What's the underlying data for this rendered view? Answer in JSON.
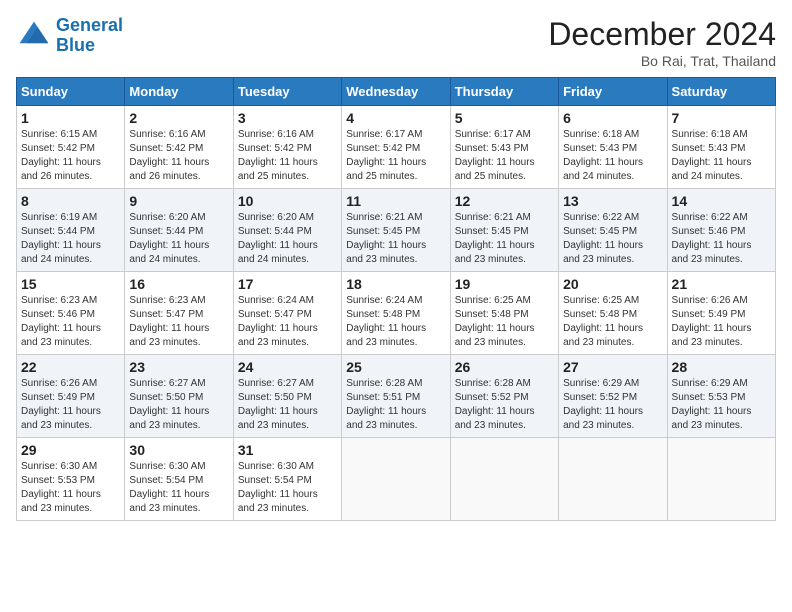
{
  "header": {
    "logo_line1": "General",
    "logo_line2": "Blue",
    "month_title": "December 2024",
    "location": "Bo Rai, Trat, Thailand"
  },
  "days_of_week": [
    "Sunday",
    "Monday",
    "Tuesday",
    "Wednesday",
    "Thursday",
    "Friday",
    "Saturday"
  ],
  "weeks": [
    [
      {
        "day": "1",
        "sunrise": "6:15 AM",
        "sunset": "5:42 PM",
        "daylight": "11 hours and 26 minutes."
      },
      {
        "day": "2",
        "sunrise": "6:16 AM",
        "sunset": "5:42 PM",
        "daylight": "11 hours and 26 minutes."
      },
      {
        "day": "3",
        "sunrise": "6:16 AM",
        "sunset": "5:42 PM",
        "daylight": "11 hours and 25 minutes."
      },
      {
        "day": "4",
        "sunrise": "6:17 AM",
        "sunset": "5:42 PM",
        "daylight": "11 hours and 25 minutes."
      },
      {
        "day": "5",
        "sunrise": "6:17 AM",
        "sunset": "5:43 PM",
        "daylight": "11 hours and 25 minutes."
      },
      {
        "day": "6",
        "sunrise": "6:18 AM",
        "sunset": "5:43 PM",
        "daylight": "11 hours and 24 minutes."
      },
      {
        "day": "7",
        "sunrise": "6:18 AM",
        "sunset": "5:43 PM",
        "daylight": "11 hours and 24 minutes."
      }
    ],
    [
      {
        "day": "8",
        "sunrise": "6:19 AM",
        "sunset": "5:44 PM",
        "daylight": "11 hours and 24 minutes."
      },
      {
        "day": "9",
        "sunrise": "6:20 AM",
        "sunset": "5:44 PM",
        "daylight": "11 hours and 24 minutes."
      },
      {
        "day": "10",
        "sunrise": "6:20 AM",
        "sunset": "5:44 PM",
        "daylight": "11 hours and 24 minutes."
      },
      {
        "day": "11",
        "sunrise": "6:21 AM",
        "sunset": "5:45 PM",
        "daylight": "11 hours and 23 minutes."
      },
      {
        "day": "12",
        "sunrise": "6:21 AM",
        "sunset": "5:45 PM",
        "daylight": "11 hours and 23 minutes."
      },
      {
        "day": "13",
        "sunrise": "6:22 AM",
        "sunset": "5:45 PM",
        "daylight": "11 hours and 23 minutes."
      },
      {
        "day": "14",
        "sunrise": "6:22 AM",
        "sunset": "5:46 PM",
        "daylight": "11 hours and 23 minutes."
      }
    ],
    [
      {
        "day": "15",
        "sunrise": "6:23 AM",
        "sunset": "5:46 PM",
        "daylight": "11 hours and 23 minutes."
      },
      {
        "day": "16",
        "sunrise": "6:23 AM",
        "sunset": "5:47 PM",
        "daylight": "11 hours and 23 minutes."
      },
      {
        "day": "17",
        "sunrise": "6:24 AM",
        "sunset": "5:47 PM",
        "daylight": "11 hours and 23 minutes."
      },
      {
        "day": "18",
        "sunrise": "6:24 AM",
        "sunset": "5:48 PM",
        "daylight": "11 hours and 23 minutes."
      },
      {
        "day": "19",
        "sunrise": "6:25 AM",
        "sunset": "5:48 PM",
        "daylight": "11 hours and 23 minutes."
      },
      {
        "day": "20",
        "sunrise": "6:25 AM",
        "sunset": "5:48 PM",
        "daylight": "11 hours and 23 minutes."
      },
      {
        "day": "21",
        "sunrise": "6:26 AM",
        "sunset": "5:49 PM",
        "daylight": "11 hours and 23 minutes."
      }
    ],
    [
      {
        "day": "22",
        "sunrise": "6:26 AM",
        "sunset": "5:49 PM",
        "daylight": "11 hours and 23 minutes."
      },
      {
        "day": "23",
        "sunrise": "6:27 AM",
        "sunset": "5:50 PM",
        "daylight": "11 hours and 23 minutes."
      },
      {
        "day": "24",
        "sunrise": "6:27 AM",
        "sunset": "5:50 PM",
        "daylight": "11 hours and 23 minutes."
      },
      {
        "day": "25",
        "sunrise": "6:28 AM",
        "sunset": "5:51 PM",
        "daylight": "11 hours and 23 minutes."
      },
      {
        "day": "26",
        "sunrise": "6:28 AM",
        "sunset": "5:52 PM",
        "daylight": "11 hours and 23 minutes."
      },
      {
        "day": "27",
        "sunrise": "6:29 AM",
        "sunset": "5:52 PM",
        "daylight": "11 hours and 23 minutes."
      },
      {
        "day": "28",
        "sunrise": "6:29 AM",
        "sunset": "5:53 PM",
        "daylight": "11 hours and 23 minutes."
      }
    ],
    [
      {
        "day": "29",
        "sunrise": "6:30 AM",
        "sunset": "5:53 PM",
        "daylight": "11 hours and 23 minutes."
      },
      {
        "day": "30",
        "sunrise": "6:30 AM",
        "sunset": "5:54 PM",
        "daylight": "11 hours and 23 minutes."
      },
      {
        "day": "31",
        "sunrise": "6:30 AM",
        "sunset": "5:54 PM",
        "daylight": "11 hours and 23 minutes."
      },
      null,
      null,
      null,
      null
    ]
  ]
}
